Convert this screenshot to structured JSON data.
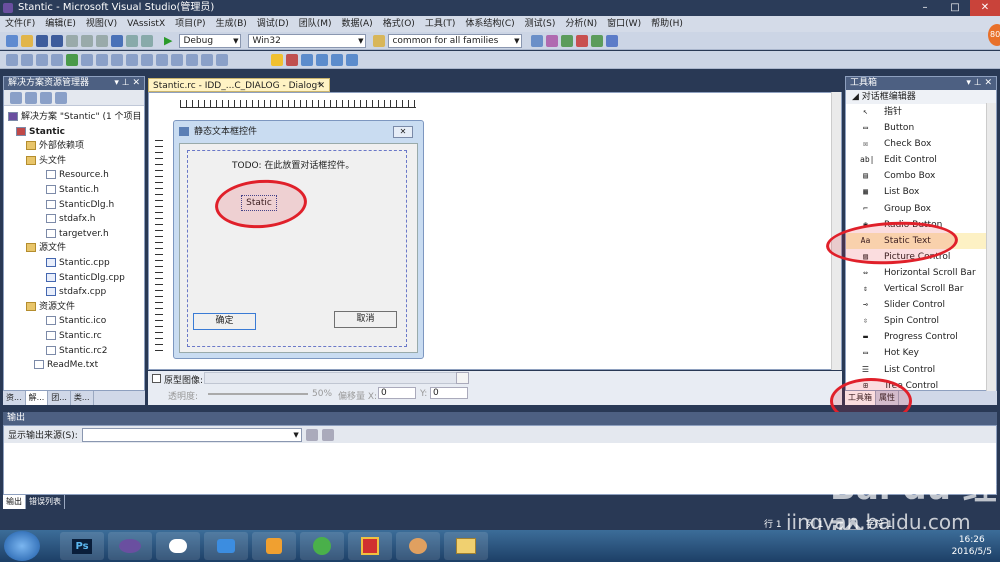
{
  "window": {
    "title": "Stantic - Microsoft Visual Studio(管理员)",
    "min": "–",
    "max": "□",
    "close": "✕"
  },
  "menu": [
    "文件(F)",
    "编辑(E)",
    "视图(V)",
    "VAssistX",
    "项目(P)",
    "生成(B)",
    "调试(D)",
    "团队(M)",
    "数据(A)",
    "格式(O)",
    "工具(T)",
    "体系结构(C)",
    "测试(S)",
    "分析(N)",
    "窗口(W)",
    "帮助(H)"
  ],
  "toolbar": {
    "config": "Debug",
    "platform": "Win32",
    "search": "common for all families"
  },
  "solution": {
    "title": "解决方案资源管理器",
    "items": [
      "解决方案 \"Stantic\" (1 个项目",
      "Stantic",
      "外部依赖项",
      "头文件",
      "Resource.h",
      "Stantic.h",
      "StanticDlg.h",
      "stdafx.h",
      "targetver.h",
      "源文件",
      "Stantic.cpp",
      "StanticDlg.cpp",
      "stdafx.cpp",
      "资源文件",
      "Stantic.ico",
      "Stantic.rc",
      "Stantic.rc2",
      "ReadMe.txt"
    ],
    "tabs": [
      "资...",
      "解...",
      "团...",
      "类..."
    ]
  },
  "editor": {
    "tab": "Stantic.rc - IDD_...C_DIALOG - Dialog*",
    "dialog_title": "静态文本框控件",
    "todo": "TODO: 在此放置对话框控件。",
    "static_label": "Static",
    "ok": "确定",
    "cancel": "取消",
    "close_glyph": "✕"
  },
  "props": {
    "proto_label": "原型图像:",
    "opacity_label": "透明度:",
    "opacity_value": "50%",
    "offset_x_label": "偏移量 X:",
    "offset_x": "0",
    "y_label": "Y:",
    "y": "0"
  },
  "toolbox": {
    "title": "工具箱",
    "group": "对话框编辑器",
    "items": [
      {
        "icon": "pointer-icon",
        "glyph": "↖",
        "label": "指针"
      },
      {
        "icon": "button-icon",
        "glyph": "▭",
        "label": "Button"
      },
      {
        "icon": "checkbox-icon",
        "glyph": "☒",
        "label": "Check Box"
      },
      {
        "icon": "edit-control-icon",
        "glyph": "ab|",
        "label": "Edit Control"
      },
      {
        "icon": "combo-box-icon",
        "glyph": "▤",
        "label": "Combo Box"
      },
      {
        "icon": "list-box-icon",
        "glyph": "▦",
        "label": "List Box"
      },
      {
        "icon": "group-box-icon",
        "glyph": "⌐",
        "label": "Group Box"
      },
      {
        "icon": "radio-button-icon",
        "glyph": "◉",
        "label": "Radio Button"
      },
      {
        "icon": "static-text-icon",
        "glyph": "Aa",
        "label": "Static Text"
      },
      {
        "icon": "picture-control-icon",
        "glyph": "▨",
        "label": "Picture Control"
      },
      {
        "icon": "hscroll-icon",
        "glyph": "⇔",
        "label": "Horizontal Scroll Bar"
      },
      {
        "icon": "vscroll-icon",
        "glyph": "⇕",
        "label": "Vertical Scroll Bar"
      },
      {
        "icon": "slider-icon",
        "glyph": "⊸",
        "label": "Slider Control"
      },
      {
        "icon": "spin-icon",
        "glyph": "⇳",
        "label": "Spin Control"
      },
      {
        "icon": "progress-icon",
        "glyph": "▬",
        "label": "Progress Control"
      },
      {
        "icon": "hotkey-icon",
        "glyph": "▭",
        "label": "Hot Key"
      },
      {
        "icon": "list-control-icon",
        "glyph": "☰",
        "label": "List Control"
      },
      {
        "icon": "tree-control-icon",
        "glyph": "⊞",
        "label": "Tree Control"
      }
    ],
    "tabs": [
      "工具箱",
      "属性"
    ]
  },
  "output": {
    "title": "输出",
    "source_label": "显示输出来源(S):",
    "tabs": [
      "输出",
      "错误列表"
    ]
  },
  "status": {
    "ln": "行 1",
    "col": "列 1",
    "ch": "字符 1"
  },
  "taskbar": {
    "time": "16:26",
    "date": "2016/5/5",
    "ps": "Ps"
  },
  "watermark": {
    "brand": "Bai du 经验",
    "url": "jingyan.baidu.com"
  }
}
